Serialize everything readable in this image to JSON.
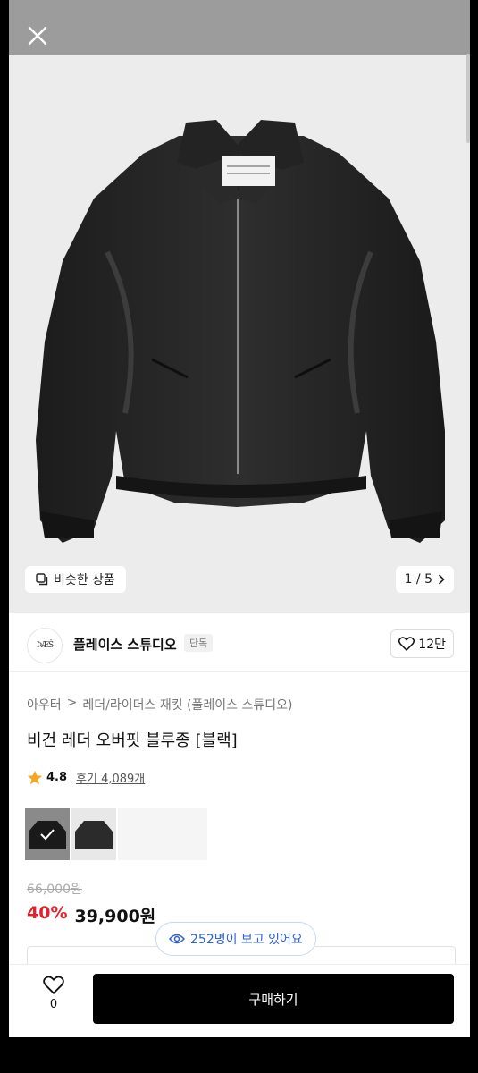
{
  "header": {
    "close_icon": "close-icon"
  },
  "gallery": {
    "similar_label": "비슷한 상품",
    "page_indicator": "1 / 5"
  },
  "brand": {
    "logo_text": "ÞÆŠ",
    "name": "플레이스 스튜디오",
    "badge": "단독",
    "likes": "12만"
  },
  "breadcrumb": {
    "category": "아우터",
    "separator": ">",
    "subcategory": "레더/라이더스 재킷 (플레이스 스튜디오)"
  },
  "product": {
    "title": "비건 레더 오버핏 블루종 [블랙]",
    "rating": "4.8",
    "review_label": "후기 4,089개",
    "original_price": "66,000원",
    "discount": "40%",
    "sale_price": "39,900원"
  },
  "viewers": {
    "label": "252명이 보고 있어요"
  },
  "bottom": {
    "wish_count": "0",
    "buy_label": "구매하기"
  },
  "colors": {
    "accent_red": "#e0242f",
    "viewers_blue": "#2f63d6",
    "star": "#f5a623"
  }
}
